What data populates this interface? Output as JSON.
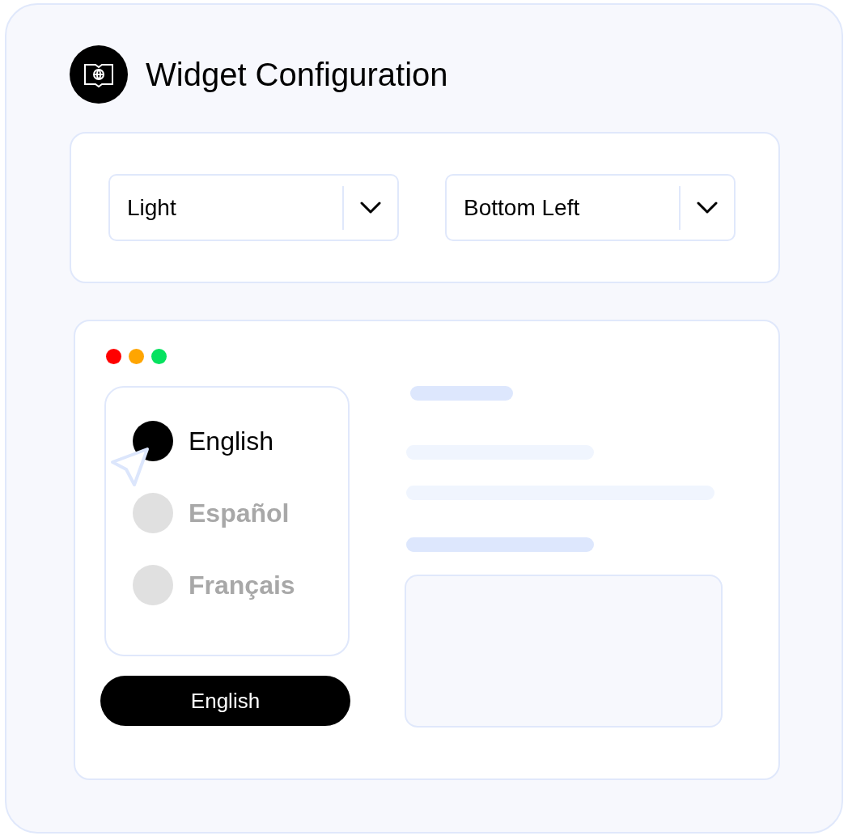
{
  "header": {
    "title": "Widget Configuration"
  },
  "selects": [
    {
      "value": "Light"
    },
    {
      "value": "Bottom Left"
    }
  ],
  "preview": {
    "window_dots": [
      {
        "color": "#ff0000"
      },
      {
        "color": "#ffa500"
      },
      {
        "color": "#05e25f"
      }
    ],
    "languages": [
      {
        "label": "English",
        "selected": true
      },
      {
        "label": "Español",
        "selected": false
      },
      {
        "label": "Français",
        "selected": false
      }
    ],
    "language_button": {
      "label": "English"
    }
  }
}
